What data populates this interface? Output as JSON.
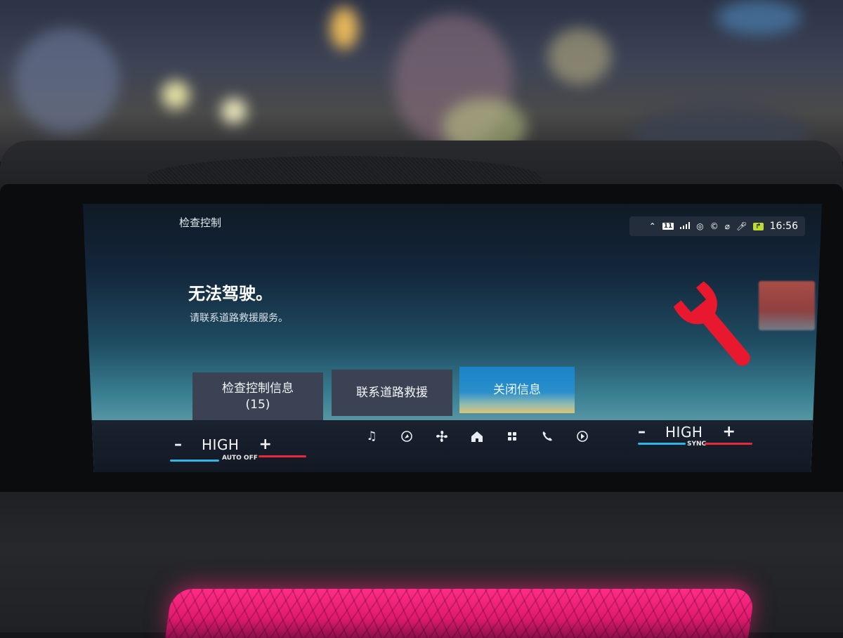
{
  "screen": {
    "title": "检查控制",
    "status_bar": {
      "icons": [
        "chevron-up-icon",
        "sim-11-icon",
        "signal-bars-icon",
        "connected-services-icon",
        "connectivity-icon",
        "wifi-off-icon",
        "microphone-icon",
        "car-status-icon"
      ],
      "sim_label": "11",
      "time": "16:56"
    }
  },
  "message": {
    "title": "无法驾驶。",
    "subtitle": "请联系道路救援服务。",
    "icon": "wrench-icon",
    "icon_color": "#e8182e"
  },
  "actions": {
    "check_control_label": "检查控制信息",
    "check_control_count": "(15)",
    "roadside_label": "联系道路救援",
    "close_label": "关闭信息",
    "close_color": "#1a84c8"
  },
  "climate": {
    "left": {
      "minus": "–",
      "value": "HIGH",
      "plus": "+",
      "sub_label": "AUTO OFF"
    },
    "right": {
      "minus": "–",
      "value": "HIGH",
      "plus": "+",
      "sub_label": "SYNC"
    },
    "cool_color": "#2fb6e6",
    "warm_color": "#e8283c"
  },
  "dock": {
    "items": [
      "music-icon",
      "navigation-icon",
      "fan-icon",
      "home-icon",
      "apps-grid-icon",
      "phone-icon",
      "connected-drive-icon"
    ]
  }
}
